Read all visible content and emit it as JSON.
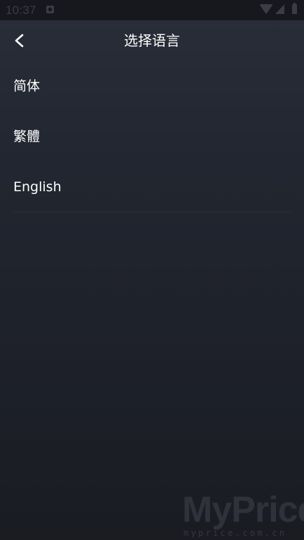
{
  "status_bar": {
    "time": "10:37",
    "icons": [
      "notification-icon",
      "wifi-icon",
      "signal-icon",
      "battery-icon"
    ]
  },
  "header": {
    "title": "选择语言",
    "back_icon": "chevron-left-icon"
  },
  "languages": [
    {
      "label": "简体"
    },
    {
      "label": "繁體"
    },
    {
      "label": "English"
    }
  ],
  "watermark": {
    "main": "MyPrice",
    "sub": "myprice.com.cn"
  },
  "colors": {
    "background": "#1d2028",
    "status_bar": "#16181d",
    "text": "#ffffff",
    "divider": "#2c3039"
  }
}
